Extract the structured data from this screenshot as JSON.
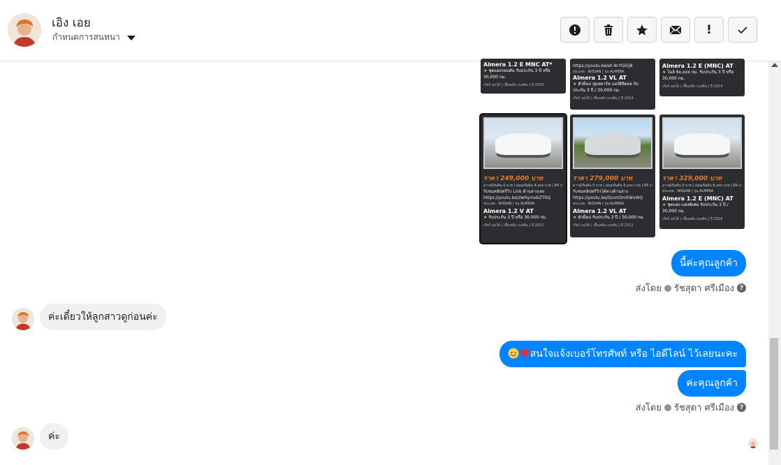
{
  "header": {
    "name": "เอิง เอย",
    "subtitle": "กำหนดการสนทนา",
    "toolbar": [
      {
        "name": "report-button",
        "icon": "alert-circle-icon",
        "glyph": "!"
      },
      {
        "name": "delete-button",
        "icon": "trash-icon",
        "glyph": ""
      },
      {
        "name": "star-button",
        "icon": "star-icon",
        "glyph": "★"
      },
      {
        "name": "mail-button",
        "icon": "envelope-icon",
        "glyph": ""
      },
      {
        "name": "important-button",
        "icon": "exclamation-icon",
        "glyph": "!"
      },
      {
        "name": "done-button",
        "icon": "check-icon",
        "glyph": "✓"
      }
    ]
  },
  "cards": [
    {
      "model": "Almera 1.2 E MNC AT*",
      "line1": "ชุดแต่งรอบคัน รับประกัน 3 ปี หรือ",
      "line2": "30,000 กม.",
      "foot": "เกียร์ ออโต้ | เชื้อเพลิง เบนซิน | ปี 2016"
    },
    {
      "link": "https://youtu.be/et-9cYGiGj8",
      "model": "Almera 1.2 VL AT",
      "line1": "ตัวท็อป ปุ่มสตาร์ท แอร์ดิจิตอล รับ",
      "line2": "ประกัน 3 ปี / 30,000 กม.",
      "foot": "เกียร์ ออโต้ | เชื้อเพลิง เบนซิน | ปี 2014"
    },
    {
      "model": "Almera 1.2 E (MNC) AT",
      "line1": "ไมล์ 6x,xxx กม. รับประกัน 3 ปี หรือ",
      "line2": "30,000 กม.",
      "foot": "เกียร์ ออโต้ | เชื้อเพลิง เบนซิน | ปี 2014"
    },
    {
      "price": "ราคา 249,000 บาท",
      "note": "รับชมคลิปพรีวิว Link ด้านล่างเลย",
      "link": "https://youtu.be/zwHymxbZTRQ",
      "model": "Almera 1.2 V AT",
      "line1": "รับประกัน 3 ปี หรือ 30,000 กม.",
      "foot": "เกียร์ ออโต้ | เชื้อเพลิง เบนซิน | ปี 2012"
    },
    {
      "price": "ราคา 279,000 บาท",
      "note": "รับชมคลิปพรีวิวได้ทางด้านล่าง",
      "link": "https://youtu.be/SzvmSm5WxWQ",
      "model": "Almera 1.2 VL AT",
      "line1": "ตัวท็อป รับประกัน 3 ปี / 30,000 กม.",
      "foot": "เกียร์ ออโต้ | เชื้อเพลิง เบนซิน | ปี 2012"
    },
    {
      "price": "ราคา 329,000 บาท",
      "model": "Almera 1.2 E (MNC) AT",
      "line1": "ชุดแต่ง แต่งพิเศษ รับประกัน 3 ปี /",
      "line2": "30,000 กม.",
      "foot": "เกียร์ ออโต้ | เชื้อเพลิง เบนซิน | ปี 2016"
    }
  ],
  "messages": {
    "out1": "นี้ค่ะคุณลูกค้า",
    "sent_by_prefix": "ส่งโดย",
    "sent_by_name": "รัชสุดา ศรีเมือง",
    "in1": "ค่ะเดี๋ยวให้ลูกสาวดูก่อนค่ะ",
    "out2": "สนใจแจ้งเบอร์โทรศัพท์ หรือ ไอดีไลน์  ไว้เลยนะคะ",
    "out3": "ค่ะคุณลูกค้า",
    "in2": "ค่ะ"
  },
  "help_glyph": "?"
}
